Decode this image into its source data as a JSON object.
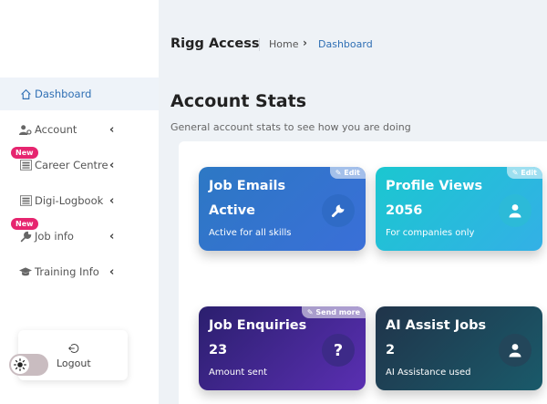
{
  "app": {
    "brand": "Rigg Access"
  },
  "breadcrumb": {
    "home": "Home",
    "separator": "›",
    "current": "Dashboard"
  },
  "page": {
    "title": "Account Stats",
    "subtitle": "General account stats to see how you are doing"
  },
  "sidebar": {
    "items": [
      {
        "label": "Dashboard",
        "icon": "home-icon",
        "active": true,
        "has_chevron": false
      },
      {
        "label": "Account",
        "icon": "user-gear-icon",
        "has_chevron": true
      },
      {
        "label": "Career Centre",
        "icon": "list-icon",
        "has_chevron": true,
        "badge": "New"
      },
      {
        "label": "Digi-Logbook",
        "icon": "list-icon",
        "has_chevron": true
      },
      {
        "label": "Job info",
        "icon": "wrench-icon",
        "has_chevron": true,
        "badge": "New"
      },
      {
        "label": "Training Info",
        "icon": "graduation-cap-icon",
        "has_chevron": true
      }
    ],
    "chevron": "‹",
    "logout": {
      "icon": "logout-icon",
      "label": "Logout"
    },
    "theme_toggle": {
      "icon": "sun-icon",
      "state": "light"
    }
  },
  "cards": [
    {
      "title": "Job Emails",
      "value": "Active",
      "note": "Active for all skills",
      "tag": "Edit",
      "icon": "wrench-icon"
    },
    {
      "title": "Profile Views",
      "value": "2056",
      "note": "For companies only",
      "tag": "Edit",
      "icon": "user-icon"
    },
    {
      "title": "Job Enquiries",
      "value": "23",
      "note": "Amount sent",
      "tag": "Send more",
      "icon": "question-icon",
      "icon_text": "?"
    },
    {
      "title": "AI Assist Jobs",
      "value": "2",
      "note": "AI Assistance used",
      "icon": "user-icon"
    }
  ],
  "colors": {
    "accent": "#2f6fb4",
    "badge": "#e6256f",
    "card_job_emails": "#2d78c4",
    "card_profile_views": "#1bc7d0",
    "card_job_enquiries": "#4a2a9a",
    "card_ai_assist": "#20344a"
  }
}
